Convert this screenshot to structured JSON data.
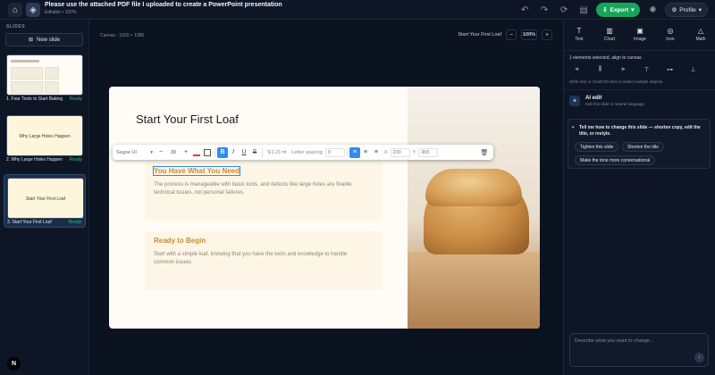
{
  "header": {
    "title": "Please use the attached PDF file I uploaded to create a PowerPoint presentation",
    "subtitle": "Editable • 100%",
    "export_label": "Export",
    "profile_label": "Profile"
  },
  "slides_panel": {
    "label": "SLIDES",
    "new_slide_label": "New slide",
    "items": [
      {
        "label": "1. Four Tools to Start Baking",
        "status": "Ready",
        "thumb_text": ""
      },
      {
        "label": "2. Why Large Holes Happen",
        "status": "Ready",
        "thumb_text": "Why Large Holes Happen"
      },
      {
        "label": "3. Start Your First Loaf",
        "status": "Ready",
        "thumb_text": "Start Your First Loaf"
      }
    ]
  },
  "canvas": {
    "label": "Canvas · 1920 × 1080",
    "slide_name": "Start Your First Loaf",
    "zoom": "100%",
    "zoom_out": "−",
    "zoom_in": "+"
  },
  "slide": {
    "title": "Start Your First Loaf",
    "box1_head": "You Have What You Need",
    "box1_body": "The process is manageable with basic tools, and defects like large holes are fixable technical issues, not personal failures.",
    "box2_head": "Ready to Begin",
    "box2_body": "Start with a simple loaf, knowing that you have the tools and knowledge to handle common issues."
  },
  "text_toolbar": {
    "font": "Segoe UI",
    "minus": "−",
    "size": "30",
    "plus": "+",
    "bold": "B",
    "italic": "I",
    "underline": "U",
    "strike": "S",
    "line_height": "1.21×",
    "letter_spacing_label": "Letter spacing",
    "letter_spacing": "0",
    "x_label": "X",
    "x_value": "200",
    "y_label": "Y",
    "y_value": "365"
  },
  "right_panel": {
    "tools": [
      {
        "label": "Text",
        "icon": "T"
      },
      {
        "label": "Chart",
        "icon": "▥"
      },
      {
        "label": "Image",
        "icon": "▣"
      },
      {
        "label": "Icon",
        "icon": "◎"
      },
      {
        "label": "Math",
        "icon": "△"
      }
    ],
    "selection_info": "1 elements selected, align to canvas",
    "hint": "Shift-click or Cmd/Ctrl-click to select multiple objects.",
    "ai_title": "AI edit",
    "ai_subtitle": "Edit this slide in natural language",
    "ai_message": "Tell me how to change this slide — shorten copy, edit the title, or restyle.",
    "chips": [
      "Tighten this slide",
      "Shorten the title",
      "Make the tone more conversational"
    ],
    "prompt_placeholder": "Describe what you want to change..."
  },
  "colors": {
    "accent": "#2f8cf0",
    "export": "#18a55a",
    "ready": "#2fbf7a",
    "heading_orange": "#c78a39"
  }
}
